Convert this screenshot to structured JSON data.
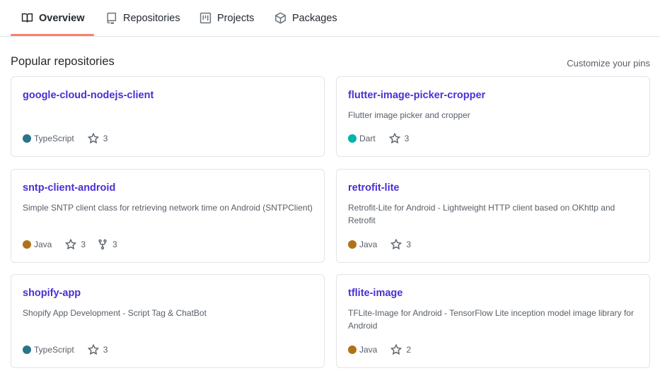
{
  "tabs": [
    {
      "label": "Overview",
      "icon": "book-icon"
    },
    {
      "label": "Repositories",
      "icon": "repo-icon"
    },
    {
      "label": "Projects",
      "icon": "project-icon"
    },
    {
      "label": "Packages",
      "icon": "package-icon"
    }
  ],
  "section": {
    "title": "Popular repositories",
    "customize_label": "Customize your pins"
  },
  "colors": {
    "accent_link": "#4b2fd3",
    "tab_underline": "#f9826c",
    "TypeScript": "#2b7489",
    "Dart": "#00b4ab",
    "Java": "#b07219"
  },
  "repos": [
    {
      "name": "google-cloud-nodejs-client",
      "description": "",
      "language": "TypeScript",
      "stars": "3"
    },
    {
      "name": "flutter-image-picker-cropper",
      "description": "Flutter image picker and cropper",
      "language": "Dart",
      "stars": "3"
    },
    {
      "name": "sntp-client-android",
      "description": "Simple SNTP client class for retrieving network time on Android (SNTPClient)",
      "language": "Java",
      "stars": "3",
      "forks": "3"
    },
    {
      "name": "retrofit-lite",
      "description": "Retrofit-Lite for Android - Lightweight HTTP client based on OKhttp and Retrofit",
      "language": "Java",
      "stars": "3"
    },
    {
      "name": "shopify-app",
      "description": "Shopify App Development - Script Tag & ChatBot",
      "language": "TypeScript",
      "stars": "3"
    },
    {
      "name": "tflite-image",
      "description": "TFLite-Image for Android - TensorFlow Lite inception model image library for Android",
      "language": "Java",
      "stars": "2"
    }
  ]
}
